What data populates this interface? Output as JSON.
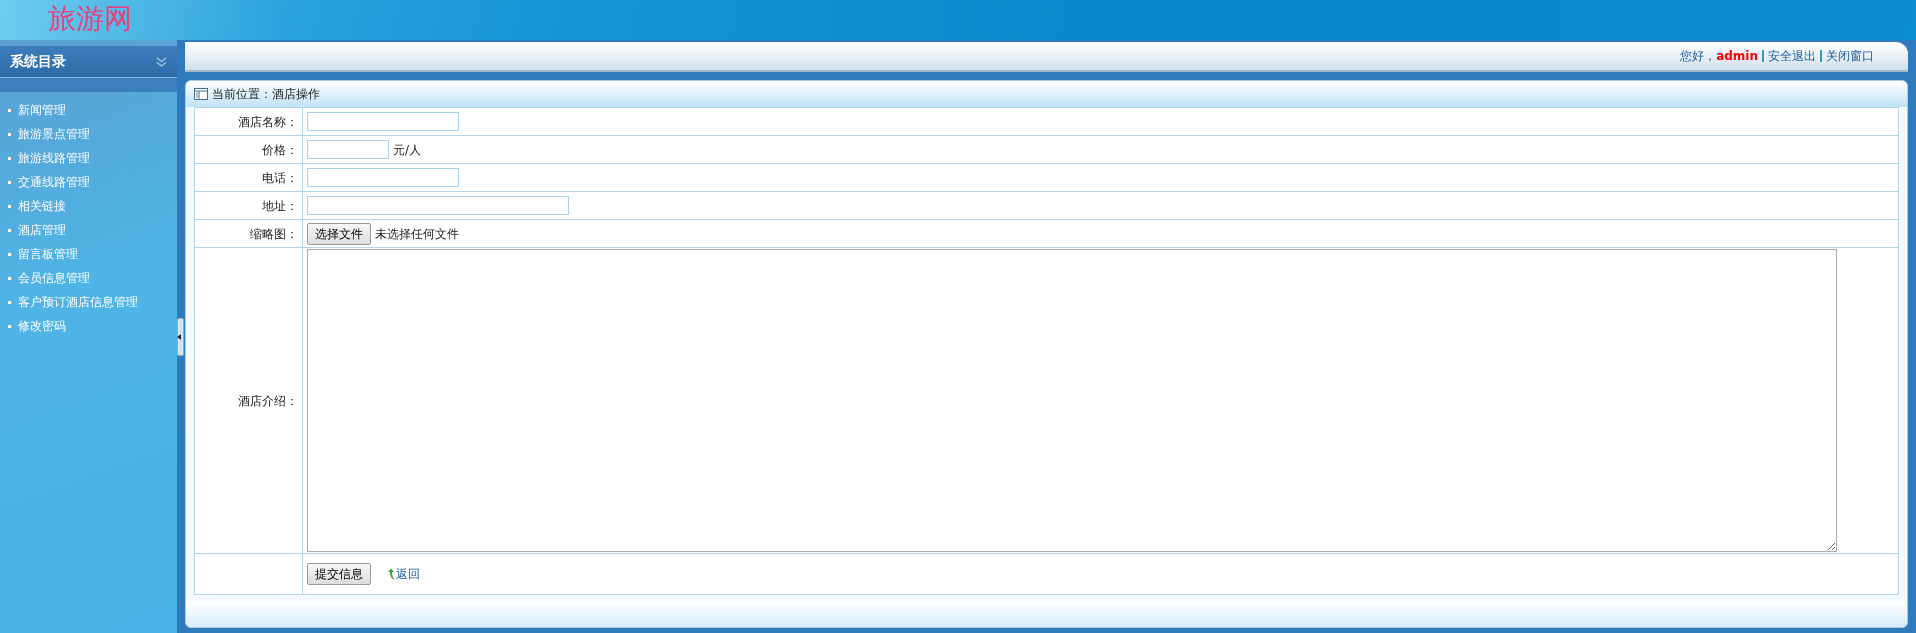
{
  "header": {
    "logo": "旅游网"
  },
  "sidebar": {
    "title": "系统目录",
    "items": [
      {
        "label": "新闻管理"
      },
      {
        "label": "旅游景点管理"
      },
      {
        "label": "旅游线路管理"
      },
      {
        "label": "交通线路管理"
      },
      {
        "label": "相关链接"
      },
      {
        "label": "酒店管理"
      },
      {
        "label": "留言板管理"
      },
      {
        "label": "会员信息管理"
      },
      {
        "label": "客户预订酒店信息管理"
      },
      {
        "label": "修改密码"
      }
    ]
  },
  "topbar": {
    "greeting": "您好，",
    "user": "admin",
    "links": [
      "安全退出",
      "关闭窗口"
    ]
  },
  "breadcrumb": "当前位置：酒店操作",
  "form": {
    "fields": [
      {
        "kind": "medium",
        "label": "酒店名称："
      },
      {
        "kind": "short",
        "label": "价格：",
        "unit": "元/人"
      },
      {
        "kind": "medium",
        "label": "电话："
      },
      {
        "kind": "wide",
        "label": "地址："
      },
      {
        "kind": "file",
        "label": "缩略图：",
        "button": "选择文件",
        "status": "未选择任何文件"
      },
      {
        "kind": "textarea",
        "label": "酒店介绍："
      }
    ],
    "submit": "提交信息",
    "back": "返回"
  }
}
